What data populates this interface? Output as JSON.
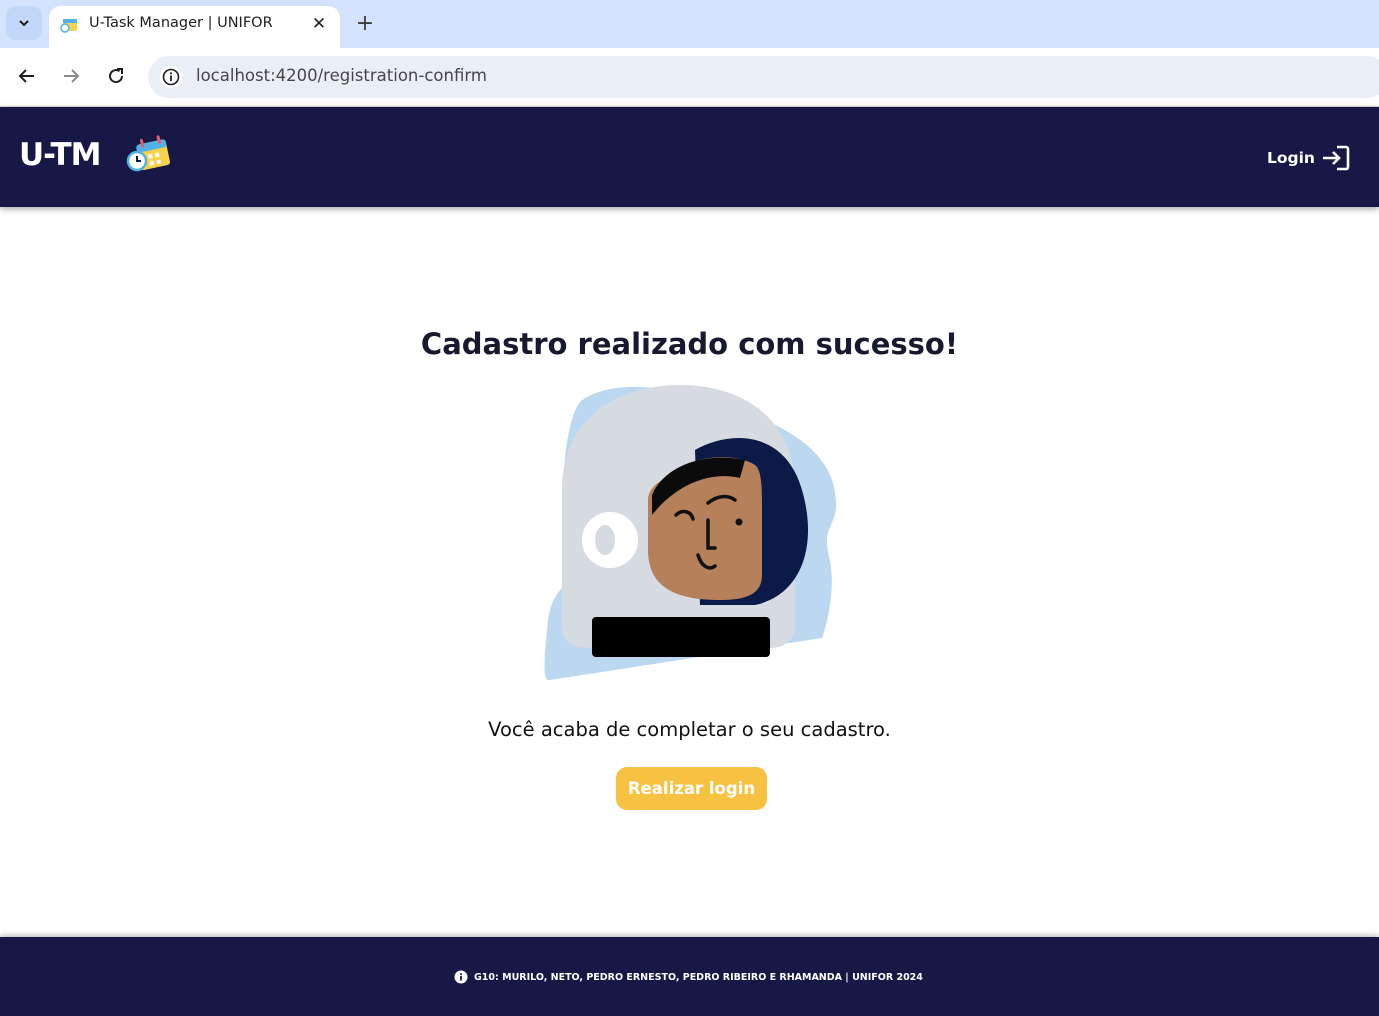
{
  "browser": {
    "tab_title": "U-Task Manager | UNIFOR",
    "tab_close_glyph": "✕",
    "new_tab_glyph": "+",
    "url": "localhost:4200/registration-confirm"
  },
  "header": {
    "brand": "U-TM",
    "login_label": "Login"
  },
  "main": {
    "title": "Cadastro realizado com sucesso!",
    "message": "Você acaba de completar o seu cadastro.",
    "cta_label": "Realizar login"
  },
  "footer": {
    "text": "G10: MURILO, NETO, PEDRO ERNESTO, PEDRO RIBEIRO E RHAMANDA |  UNIFOR 2024"
  },
  "colors": {
    "navy": "#171846",
    "accent_yellow": "#f7c242",
    "chrome_tabbar": "#d3e3fd"
  },
  "icons": [
    "chevron-down-icon",
    "favicon-calendar-icon",
    "close-icon",
    "plus-icon",
    "back-arrow-icon",
    "forward-arrow-icon",
    "reload-icon",
    "site-info-icon",
    "calendar-clock-icon",
    "login-icon",
    "info-icon"
  ]
}
